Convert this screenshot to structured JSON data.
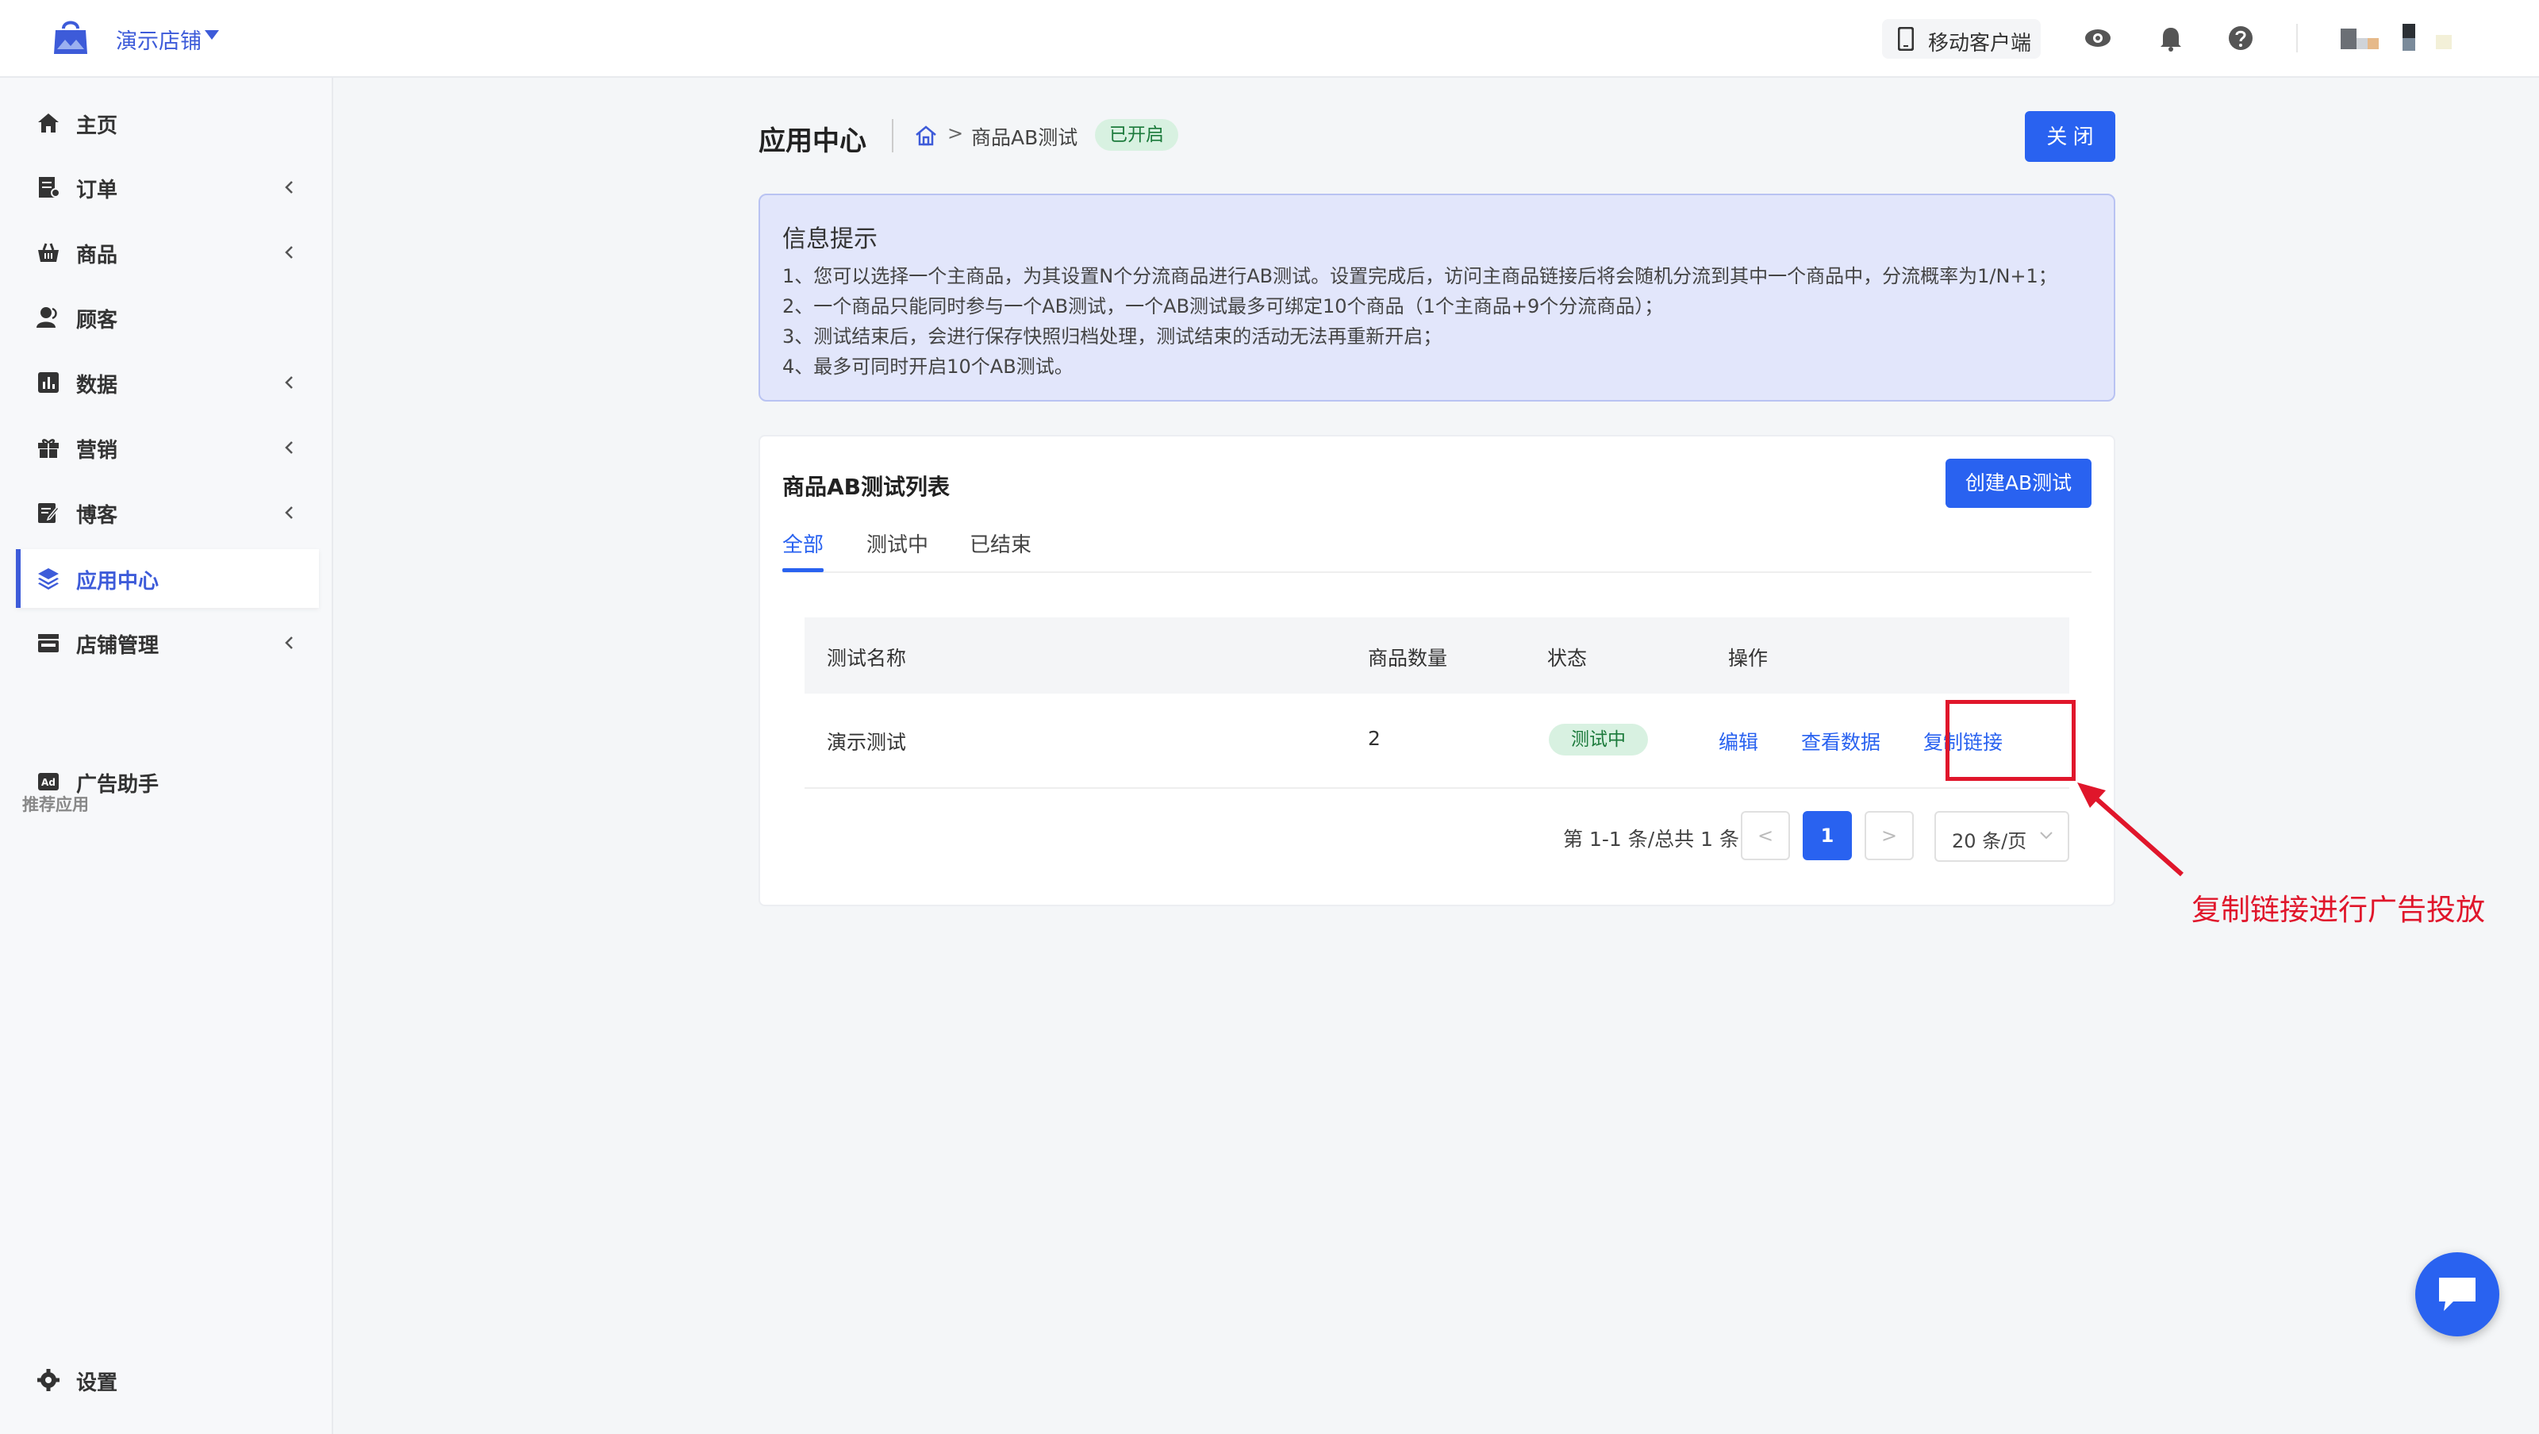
{
  "topbar": {
    "store_name": "演示店铺",
    "mobile_label": "移动客户端"
  },
  "sidebar": {
    "items": [
      {
        "label": "主页"
      },
      {
        "label": "订单"
      },
      {
        "label": "商品"
      },
      {
        "label": "顾客"
      },
      {
        "label": "数据"
      },
      {
        "label": "营销"
      },
      {
        "label": "博客"
      },
      {
        "label": "应用中心"
      },
      {
        "label": "店铺管理"
      }
    ],
    "section_title": "推荐应用",
    "recommended": [
      {
        "label": "广告助手"
      }
    ],
    "settings_label": "设置"
  },
  "header": {
    "title": "应用中心",
    "breadcrumb": "商品AB测试",
    "status_badge": "已开启",
    "close_label": "关 闭"
  },
  "info": {
    "title": "信息提示",
    "lines": [
      "1、您可以选择一个主商品，为其设置N个分流商品进行AB测试。设置完成后，访问主商品链接后将会随机分流到其中一个商品中，分流概率为1/N+1；",
      "2、一个商品只能同时参与一个AB测试，一个AB测试最多可绑定10个商品（1个主商品+9个分流商品）；",
      "3、测试结束后，会进行保存快照归档处理，测试结束的活动无法再重新开启；",
      "4、最多可同时开启10个AB测试。"
    ]
  },
  "list": {
    "title": "商品AB测试列表",
    "create_label": "创建AB测试",
    "tabs": [
      "全部",
      "测试中",
      "已结束"
    ],
    "columns": [
      "测试名称",
      "商品数量",
      "状态",
      "操作"
    ],
    "rows": [
      {
        "name": "演示测试",
        "count": "2",
        "status": "测试中",
        "actions": [
          "编辑",
          "查看数据",
          "复制链接"
        ]
      }
    ],
    "pagination": {
      "summary": "第 1-1 条/总共 1 条",
      "prev": "<",
      "current": "1",
      "next": ">",
      "page_size": "20 条/页"
    }
  },
  "annotation": {
    "text": "复制链接进行广告投放",
    "color": "#e0162b"
  },
  "colors": {
    "accent": "#2962f0",
    "brand": "#3d5bd9",
    "success_bg": "#d8f1e1",
    "success_fg": "#1b7a3b"
  }
}
